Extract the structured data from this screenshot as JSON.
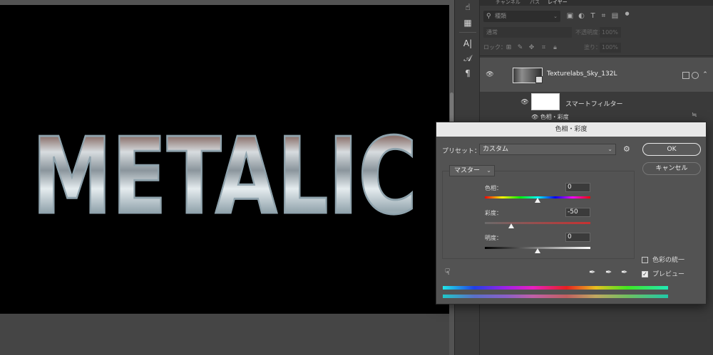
{
  "canvas": {
    "artwork_text": "METALIC"
  },
  "panel": {
    "tabs": [
      "チャンネル",
      "パス",
      "レイヤー"
    ],
    "filter_placeholder": "種類",
    "blend_mode": "通常",
    "opacity_label": "不透明度：",
    "opacity_value": "100%",
    "lock_label": "ロック：",
    "fill_label": "塗り：",
    "fill_value": "100%",
    "layer_name": "Texturelabs_Sky_132L",
    "smart_filter_label": "スマートフィルター",
    "hue_sat_filter_label": "色相・彩度"
  },
  "dialog": {
    "title": "色相・彩度",
    "preset_label": "プリセット：",
    "preset_value": "カスタム",
    "ok_label": "OK",
    "cancel_label": "キャンセル",
    "channel_value": "マスター",
    "hue_label": "色相：",
    "hue_value": "0",
    "saturation_label": "彩度：",
    "saturation_value": "-50",
    "lightness_label": "明度：",
    "lightness_value": "0",
    "colorize_label": "色彩の統一",
    "colorize_checked": false,
    "preview_label": "プレビュー",
    "preview_checked": true,
    "slider_levels": {
      "hue": 0,
      "saturation": -50,
      "lightness": 0
    }
  },
  "colors": {
    "panel_bg": "#3a3a3a",
    "dialog_bg": "#535353",
    "selected_layer": "#4f4f4f",
    "canvas": "#000000"
  },
  "icons": {
    "tools": [
      "hand-pointer-icon",
      "table-icon",
      "character-icon",
      "glyph-icon",
      "paragraph-icon"
    ],
    "layer_filters": [
      "image-filter-icon",
      "adjustment-filter-icon",
      "type-filter-icon",
      "shape-filter-icon",
      "smart-object-filter-icon"
    ],
    "locks": [
      "lock-pixels-icon",
      "lock-image-icon",
      "lock-position-icon",
      "lock-artboard-icon",
      "lock-all-icon"
    ]
  }
}
